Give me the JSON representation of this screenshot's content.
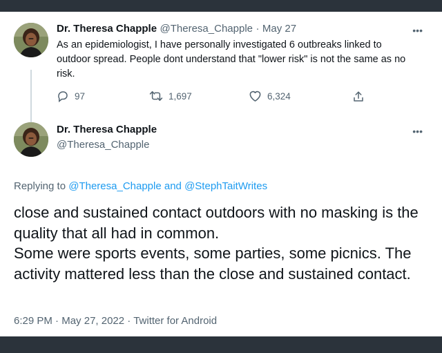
{
  "tweet_original": {
    "author_name": "Dr. Theresa Chapple",
    "author_handle": "@Theresa_Chapple",
    "separator": "·",
    "date": "May 27",
    "text": "As an epidemiologist, I have personally investigated 6 outbreaks linked to outdoor spread. People dont understand that \"lower risk\" is not the same as no risk.",
    "more_icon": "•••",
    "replies": "97",
    "retweets": "1,697",
    "likes": "6,324"
  },
  "tweet_reply": {
    "author_name": "Dr. Theresa Chapple",
    "author_handle": "@Theresa_Chapple",
    "more_icon": "•••",
    "replying_prefix": "Replying to",
    "replying_user1": "@Theresa_Chapple",
    "replying_and": "and",
    "replying_user2": "@StephTaitWrites",
    "paragraphs": [
      "close and sustained contact outdoors with no masking is the quality that all had in common.",
      "Some were sports events, some parties, some picnics. The activity mattered less than the close and sustained contact."
    ],
    "time": "6:29 PM",
    "separator": "·",
    "date": "May 27, 2022",
    "source": "Twitter for Android"
  },
  "colors": {
    "frame": "#2b333b",
    "text": "#0f1419",
    "muted": "#536471",
    "link": "#1d9bf0",
    "thread_line": "#cfd9de"
  },
  "icons": {
    "reply": "reply-icon",
    "retweet": "retweet-icon",
    "like": "heart-icon",
    "share": "share-icon",
    "more": "more-icon"
  }
}
